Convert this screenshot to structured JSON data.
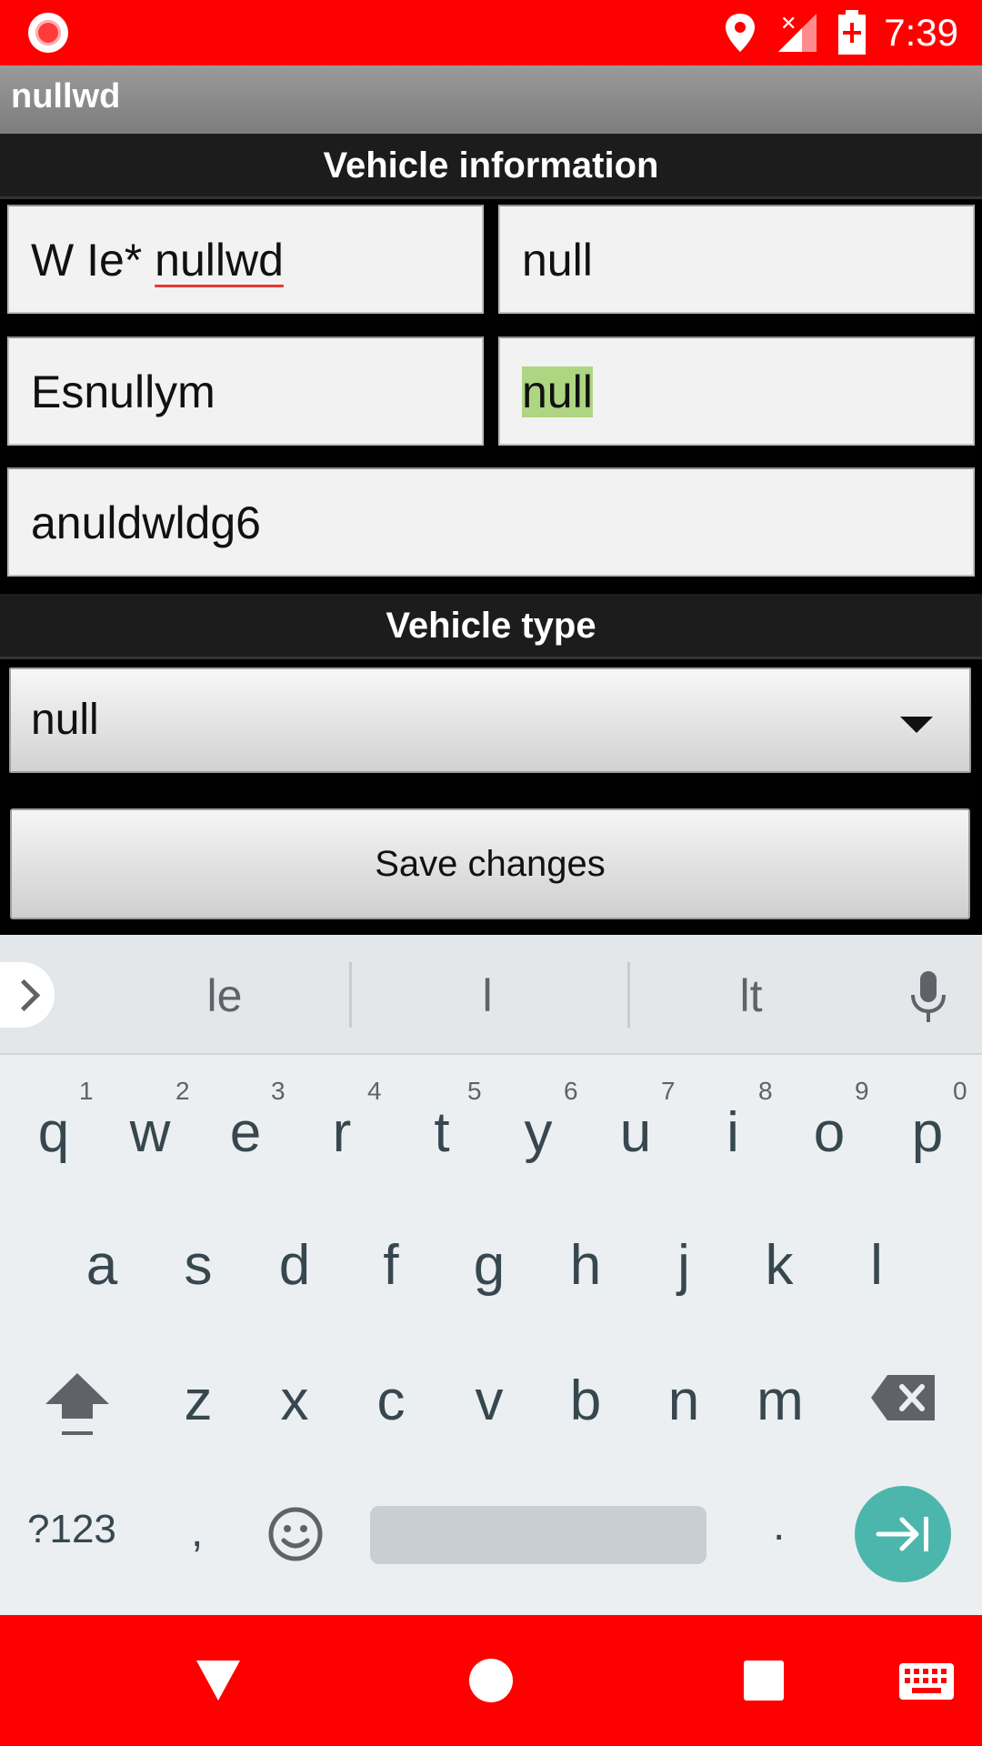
{
  "status_bar": {
    "time": "7:39",
    "icons": [
      "record-icon",
      "location-icon",
      "signal-icon",
      "battery-icon"
    ]
  },
  "app_bar": {
    "title": "nullwd"
  },
  "vehicle_info": {
    "header": "Vehicle information",
    "field1_prefix": "W Ie* ",
    "field1_word": "nullwd",
    "field2": "null",
    "field3": "Esnullym",
    "field4": "null",
    "field5": "anuldwldg6"
  },
  "vehicle_type": {
    "header": "Vehicle type",
    "selected": "null"
  },
  "save_button": {
    "label": "Save changes"
  },
  "keyboard": {
    "suggestions": [
      "le",
      "l",
      "lt"
    ],
    "row1": [
      "q",
      "w",
      "e",
      "r",
      "t",
      "y",
      "u",
      "i",
      "o",
      "p"
    ],
    "row1_hints": [
      "1",
      "2",
      "3",
      "4",
      "5",
      "6",
      "7",
      "8",
      "9",
      "0"
    ],
    "row2": [
      "a",
      "s",
      "d",
      "f",
      "g",
      "h",
      "j",
      "k",
      "l"
    ],
    "row3": [
      "z",
      "x",
      "c",
      "v",
      "b",
      "n",
      "m"
    ],
    "symbols_label": "?123",
    "comma_label": ",",
    "period_label": ".",
    "accent_color": "#4db6ac"
  },
  "colors": {
    "status_bar": "#ff0000",
    "nav_bar": "#ff0000",
    "selection": "#aed581"
  }
}
